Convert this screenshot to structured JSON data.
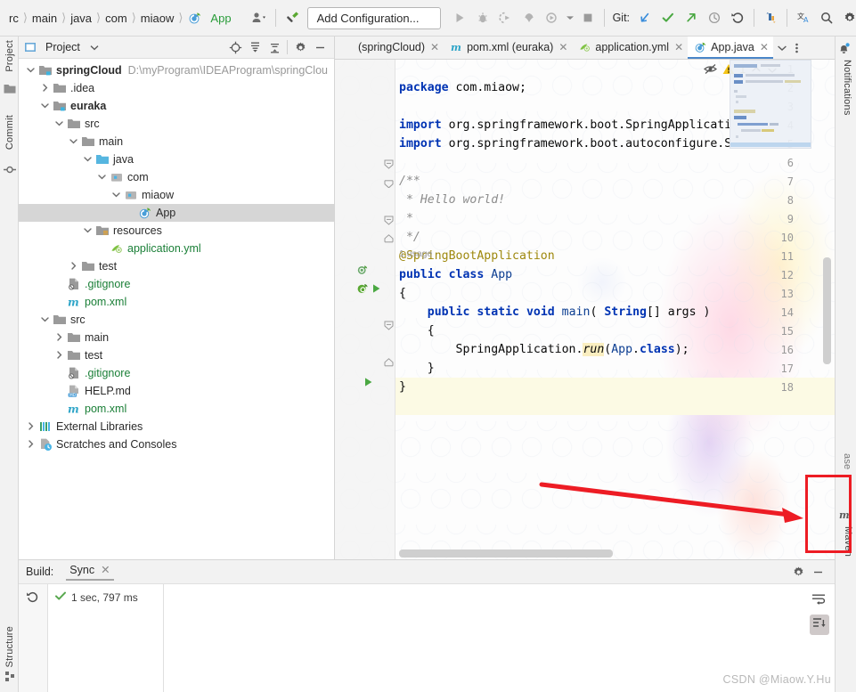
{
  "toolbar": {
    "breadcrumbs": [
      "rc",
      "main",
      "java",
      "com",
      "miaow",
      "App"
    ],
    "profile_icon": "user-profile-icon",
    "hammer_icon": "build-hammer-icon",
    "add_configuration": "Add Configuration...",
    "run_icon": "run-icon",
    "debug_icon": "debug-icon",
    "run_coverage_icon": "run-with-coverage-icon",
    "profiler_icon": "profiler-icon",
    "rerun_icon": "rerun-icon",
    "stop_icon": "stop-icon",
    "git_label": "Git:",
    "update_icon": "git-update-project-icon",
    "commit_icon": "git-commit-check-icon",
    "push_icon": "git-push-icon",
    "history_icon": "git-history-icon",
    "rollback_icon": "git-rollback-icon",
    "vcs_icon": "vcs-operations-icon",
    "translate_icon": "translate-icon",
    "search_icon": "search-everywhere-icon",
    "settings_icon": "gear-icon",
    "ide_icon": "ide-logo-icon"
  },
  "left_stripe": {
    "items": [
      {
        "label": "Project",
        "icon": "project-folder-icon"
      },
      {
        "label": "Commit",
        "icon": "commit-icon"
      }
    ],
    "bottom_items": [
      {
        "label": "Structure",
        "icon": "structure-icon"
      }
    ]
  },
  "right_stripe": {
    "items": [
      {
        "label": "Notifications",
        "icon": "notifications-bell-icon"
      },
      {
        "label": "ase",
        "icon": "database-icon"
      },
      {
        "label": "Maven",
        "icon": "maven-m-icon"
      }
    ]
  },
  "project_panel": {
    "title": "Project",
    "dropdown_icon": "chevron-down-icon",
    "tools": [
      {
        "name": "locate-icon"
      },
      {
        "name": "expand-all-icon"
      },
      {
        "name": "collapse-all-icon"
      },
      {
        "name": "gear-icon"
      },
      {
        "name": "hide-icon"
      }
    ],
    "tree": [
      {
        "indent": 0,
        "arrow": "down",
        "icon": "module-folder-icon",
        "label": "springCloud",
        "bold": true,
        "path": "D:\\myProgram\\IDEAProgram\\springClou",
        "selected": false
      },
      {
        "indent": 1,
        "arrow": "right",
        "icon": "folder-icon",
        "label": ".idea",
        "bold": false,
        "path": "",
        "selected": false
      },
      {
        "indent": 1,
        "arrow": "down",
        "icon": "module-folder-icon",
        "label": "euraka",
        "bold": true,
        "path": "",
        "selected": false
      },
      {
        "indent": 2,
        "arrow": "down",
        "icon": "folder-icon",
        "label": "src",
        "bold": false,
        "path": "",
        "selected": false
      },
      {
        "indent": 3,
        "arrow": "down",
        "icon": "folder-icon",
        "label": "main",
        "bold": false,
        "path": "",
        "selected": false
      },
      {
        "indent": 4,
        "arrow": "down",
        "icon": "source-folder-icon",
        "label": "java",
        "bold": false,
        "path": "",
        "selected": false
      },
      {
        "indent": 5,
        "arrow": "down",
        "icon": "package-icon",
        "label": "com",
        "bold": false,
        "path": "",
        "selected": false
      },
      {
        "indent": 6,
        "arrow": "down",
        "icon": "package-icon",
        "label": "miaow",
        "bold": false,
        "path": "",
        "selected": false
      },
      {
        "indent": 7,
        "arrow": "none",
        "icon": "spring-class-icon",
        "label": "App",
        "bold": false,
        "path": "",
        "selected": true
      },
      {
        "indent": 4,
        "arrow": "down",
        "icon": "resources-folder-icon",
        "label": "resources",
        "bold": false,
        "path": "",
        "selected": false
      },
      {
        "indent": 5,
        "arrow": "none",
        "icon": "spring-yml-icon",
        "label": "application.yml",
        "bold": false,
        "green": true,
        "path": "",
        "selected": false
      },
      {
        "indent": 3,
        "arrow": "right",
        "icon": "folder-icon",
        "label": "test",
        "bold": false,
        "path": "",
        "selected": false
      },
      {
        "indent": 2,
        "arrow": "none",
        "icon": "gitignore-icon",
        "label": ".gitignore",
        "bold": false,
        "green": true,
        "path": "",
        "selected": false
      },
      {
        "indent": 2,
        "arrow": "none",
        "icon": "maven-pom-icon",
        "label": "pom.xml",
        "bold": false,
        "green": true,
        "path": "",
        "selected": false
      },
      {
        "indent": 1,
        "arrow": "down",
        "icon": "folder-icon",
        "label": "src",
        "bold": false,
        "path": "",
        "selected": false
      },
      {
        "indent": 2,
        "arrow": "right",
        "icon": "folder-icon",
        "label": "main",
        "bold": false,
        "path": "",
        "selected": false
      },
      {
        "indent": 2,
        "arrow": "right",
        "icon": "folder-icon",
        "label": "test",
        "bold": false,
        "path": "",
        "selected": false
      },
      {
        "indent": 2,
        "arrow": "none",
        "icon": "gitignore-icon",
        "label": ".gitignore",
        "bold": false,
        "green": true,
        "path": "",
        "selected": false
      },
      {
        "indent": 2,
        "arrow": "none",
        "icon": "markdown-icon",
        "label": "HELP.md",
        "bold": false,
        "path": "",
        "selected": false
      },
      {
        "indent": 2,
        "arrow": "none",
        "icon": "maven-pom-icon",
        "label": "pom.xml",
        "bold": false,
        "green": true,
        "path": "",
        "selected": false
      },
      {
        "indent": 0,
        "arrow": "right",
        "icon": "external-libraries-icon",
        "label": "External Libraries",
        "bold": false,
        "path": "",
        "selected": false
      },
      {
        "indent": 0,
        "arrow": "right",
        "icon": "scratches-icon",
        "label": "Scratches and Consoles",
        "bold": false,
        "path": "",
        "selected": false
      }
    ]
  },
  "editor": {
    "tabs": [
      {
        "label": "(springCloud)",
        "icon": "cut-tab-icon",
        "active": false
      },
      {
        "label": "pom.xml (euraka)",
        "icon": "maven-pom-icon",
        "active": false
      },
      {
        "label": "application.yml",
        "icon": "spring-yml-icon",
        "active": false
      },
      {
        "label": "App.java",
        "icon": "spring-class-icon",
        "active": true
      }
    ],
    "overflow_icon": "chevron-down-icon",
    "more_icon": "more-options-icon",
    "inspections": {
      "reader_mode_icon": "hide-inspections-icon",
      "warning_icon": "warning-triangle-icon",
      "warning_count": "1",
      "prev_icon": "prev-problem-icon",
      "next_icon": "next-problem-icon"
    },
    "lines": [
      {
        "n": 1,
        "text": "package com.miaow;"
      },
      {
        "n": 2,
        "text": ""
      },
      {
        "n": 3,
        "text": "import org.springframework.boot.SpringApplicati"
      },
      {
        "n": 4,
        "text": "import org.springframework.boot.autoconfigure.S"
      },
      {
        "n": 5,
        "text": ""
      },
      {
        "n": 6,
        "text": "/**"
      },
      {
        "n": 7,
        "text": " * Hello world!"
      },
      {
        "n": 8,
        "text": " *"
      },
      {
        "n": 9,
        "text": " */"
      },
      {
        "n": 10,
        "text": "@SpringBootApplication"
      },
      {
        "n": 11,
        "text": "public class App"
      },
      {
        "n": 12,
        "text": "{"
      },
      {
        "n": 13,
        "text": "    public static void main( String[] args )"
      },
      {
        "n": 14,
        "text": "    {"
      },
      {
        "n": 15,
        "text": "        SpringApplication.run(App.class);"
      },
      {
        "n": 16,
        "text": "    }"
      },
      {
        "n": 17,
        "text": "}"
      },
      {
        "n": 18,
        "text": ""
      }
    ],
    "usage_hint": "1 usage",
    "gutter_icons": [
      {
        "line": 10,
        "name": "spring-bean-icon"
      },
      {
        "line": 11,
        "name": "spring-boot-run-icon"
      },
      {
        "line": 11,
        "name": "run-gutter-icon"
      },
      {
        "line": 13,
        "name": "run-gutter-icon"
      }
    ]
  },
  "build_panel": {
    "label": "Build:",
    "tab": "Sync",
    "close_icon": "close-icon",
    "gear_icon": "gear-icon",
    "hide_icon": "hide-icon",
    "rerun_icon": "rerun-icon",
    "soft_wrap_icon": "soft-wrap-icon",
    "scroll_end_icon": "scroll-to-end-icon",
    "result_icon": "success-check-icon",
    "result_text": "1 sec, 797 ms"
  },
  "annotations": {
    "arrow_name": "red-pointer-arrow",
    "highlight_name": "maven-button-highlight",
    "accent_color": "#ed1c24"
  },
  "watermark": "CSDN @Miaow.Y.Hu"
}
